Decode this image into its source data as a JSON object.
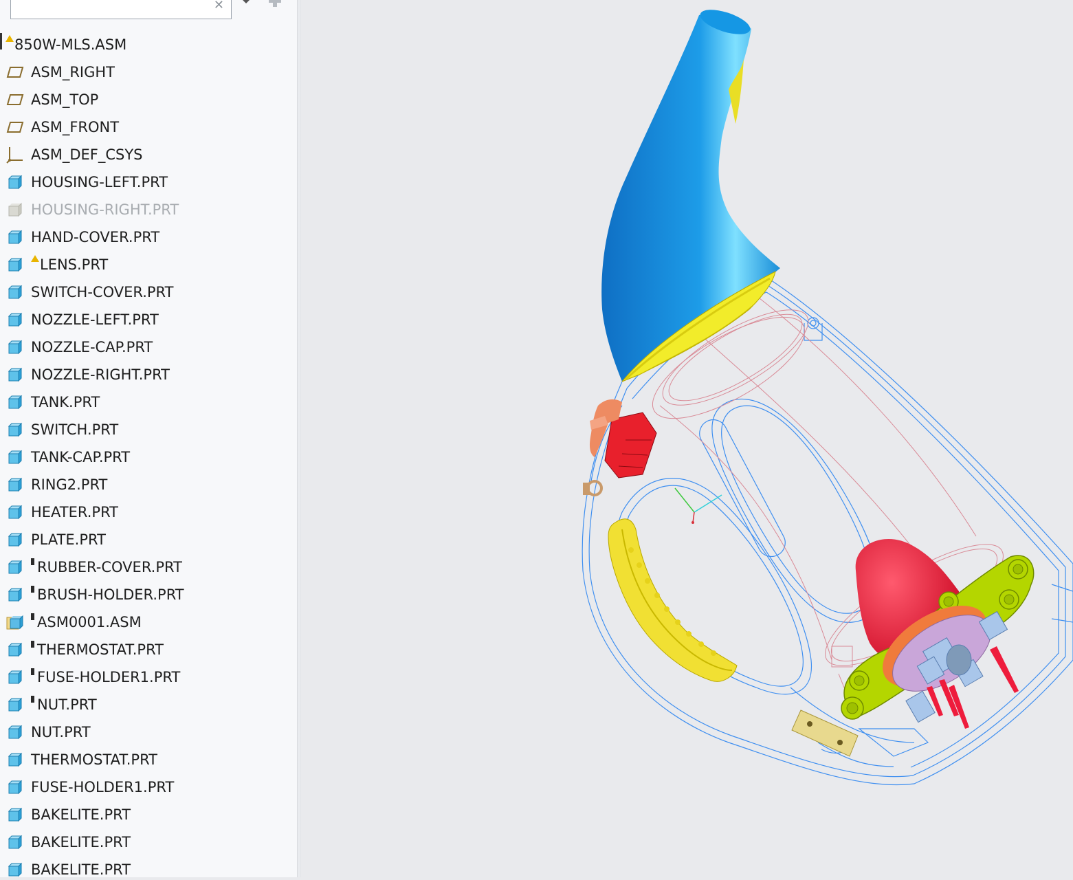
{
  "search": {
    "value": "",
    "clear_glyph": "✕"
  },
  "toolbar": {
    "filter_icon": "chevron-down-icon",
    "add_icon": "plus-icon"
  },
  "tree": [
    {
      "label": "850W-MLS.ASM",
      "icon": "assembly-root",
      "marker": "warning",
      "level": "root"
    },
    {
      "label": "ASM_RIGHT",
      "icon": "datum-plane",
      "marker": ""
    },
    {
      "label": "ASM_TOP",
      "icon": "datum-plane",
      "marker": ""
    },
    {
      "label": "ASM_FRONT",
      "icon": "datum-plane",
      "marker": ""
    },
    {
      "label": "ASM_DEF_CSYS",
      "icon": "csys",
      "marker": ""
    },
    {
      "label": "HOUSING-LEFT.PRT",
      "icon": "part",
      "marker": ""
    },
    {
      "label": "HOUSING-RIGHT.PRT",
      "icon": "part-hidden",
      "marker": "",
      "dimmed": true
    },
    {
      "label": "HAND-COVER.PRT",
      "icon": "part",
      "marker": ""
    },
    {
      "label": "LENS.PRT",
      "icon": "part",
      "marker": "warning"
    },
    {
      "label": "SWITCH-COVER.PRT",
      "icon": "part",
      "marker": ""
    },
    {
      "label": "NOZZLE-LEFT.PRT",
      "icon": "part",
      "marker": ""
    },
    {
      "label": "NOZZLE-CAP.PRT",
      "icon": "part",
      "marker": ""
    },
    {
      "label": "NOZZLE-RIGHT.PRT",
      "icon": "part",
      "marker": ""
    },
    {
      "label": "TANK.PRT",
      "icon": "part",
      "marker": ""
    },
    {
      "label": "SWITCH.PRT",
      "icon": "part",
      "marker": ""
    },
    {
      "label": "TANK-CAP.PRT",
      "icon": "part",
      "marker": ""
    },
    {
      "label": "RING2.PRT",
      "icon": "part",
      "marker": ""
    },
    {
      "label": "HEATER.PRT",
      "icon": "part",
      "marker": ""
    },
    {
      "label": "PLATE.PRT",
      "icon": "part",
      "marker": ""
    },
    {
      "label": "RUBBER-COVER.PRT",
      "icon": "part",
      "marker": "packaged"
    },
    {
      "label": "BRUSH-HOLDER.PRT",
      "icon": "part",
      "marker": "packaged"
    },
    {
      "label": "ASM0001.ASM",
      "icon": "sub-assembly",
      "marker": "packaged"
    },
    {
      "label": "THERMOSTAT.PRT",
      "icon": "part",
      "marker": "packaged"
    },
    {
      "label": "FUSE-HOLDER1.PRT",
      "icon": "part",
      "marker": "packaged"
    },
    {
      "label": "NUT.PRT",
      "icon": "part",
      "marker": "packaged"
    },
    {
      "label": "NUT.PRT",
      "icon": "part",
      "marker": ""
    },
    {
      "label": "THERMOSTAT.PRT",
      "icon": "part",
      "marker": ""
    },
    {
      "label": "FUSE-HOLDER1.PRT",
      "icon": "part",
      "marker": ""
    },
    {
      "label": "BAKELITE.PRT",
      "icon": "part",
      "marker": ""
    },
    {
      "label": "BAKELITE.PRT",
      "icon": "part",
      "marker": ""
    },
    {
      "label": "BAKELITE.PRT",
      "icon": "part",
      "marker": ""
    }
  ],
  "colors": {
    "part_icon": "#29a3d6",
    "datum_icon": "#8a6d2e",
    "warning": "#e8b400",
    "viewport_bg": "#e9eaed",
    "nozzle_blue": "#1a9be6",
    "lens_yellow": "#f2ec2a",
    "handle_yellow": "#f1e033",
    "heater_red": "#ee1c3c",
    "mount_green": "#b4d600",
    "switch_red": "#e8202c",
    "cap_orange": "#ee8b62",
    "plate_lilac": "#c9a6d9",
    "plate_tan": "#e8d98e",
    "wire_blue": "#3f8ff0",
    "wire_pink": "#d98a96"
  }
}
